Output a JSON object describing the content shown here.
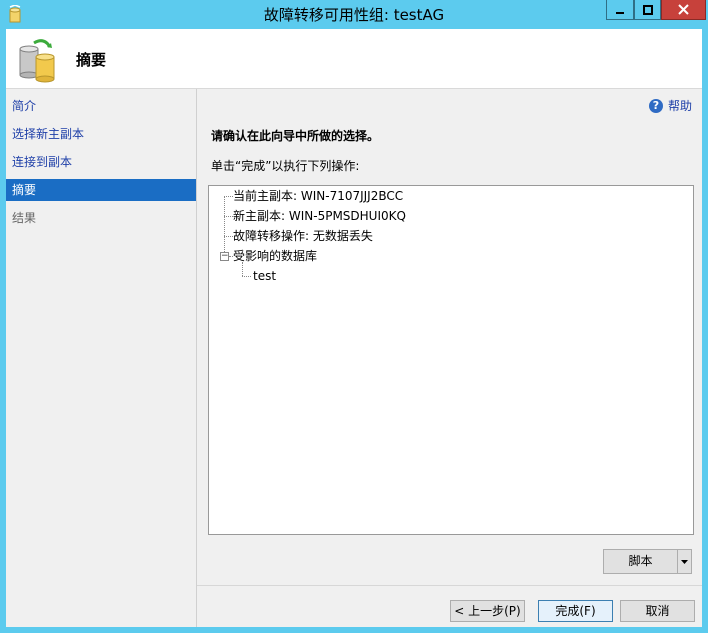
{
  "window": {
    "title": "故障转移可用性组: testAG",
    "title_bar_color": "#5ccbee",
    "close_button_color": "#c7413b"
  },
  "header": {
    "title": "摘要"
  },
  "nav": {
    "items": [
      {
        "label": "简介",
        "state": "link"
      },
      {
        "label": "选择新主副本",
        "state": "link"
      },
      {
        "label": "连接到副本",
        "state": "link"
      },
      {
        "label": "摘要",
        "state": "active"
      },
      {
        "label": "结果",
        "state": "disabled"
      }
    ],
    "active_color": "#1a6dc4"
  },
  "main": {
    "help_label": "帮助",
    "confirm_text": "请确认在此向导中所做的选择。",
    "instruction_text": "单击“完成”以执行下列操作:",
    "tree": {
      "items": [
        "当前主副本: WIN-7107JJJ2BCC",
        "新主副本: WIN-5PMSDHUI0KQ",
        "故障转移操作: 无数据丢失",
        "受影响的数据库"
      ],
      "child": "test"
    },
    "script_button": "脚本"
  },
  "footer": {
    "prev_label": "< 上一步(P)",
    "finish_label": "完成(F)",
    "cancel_label": "取消"
  }
}
